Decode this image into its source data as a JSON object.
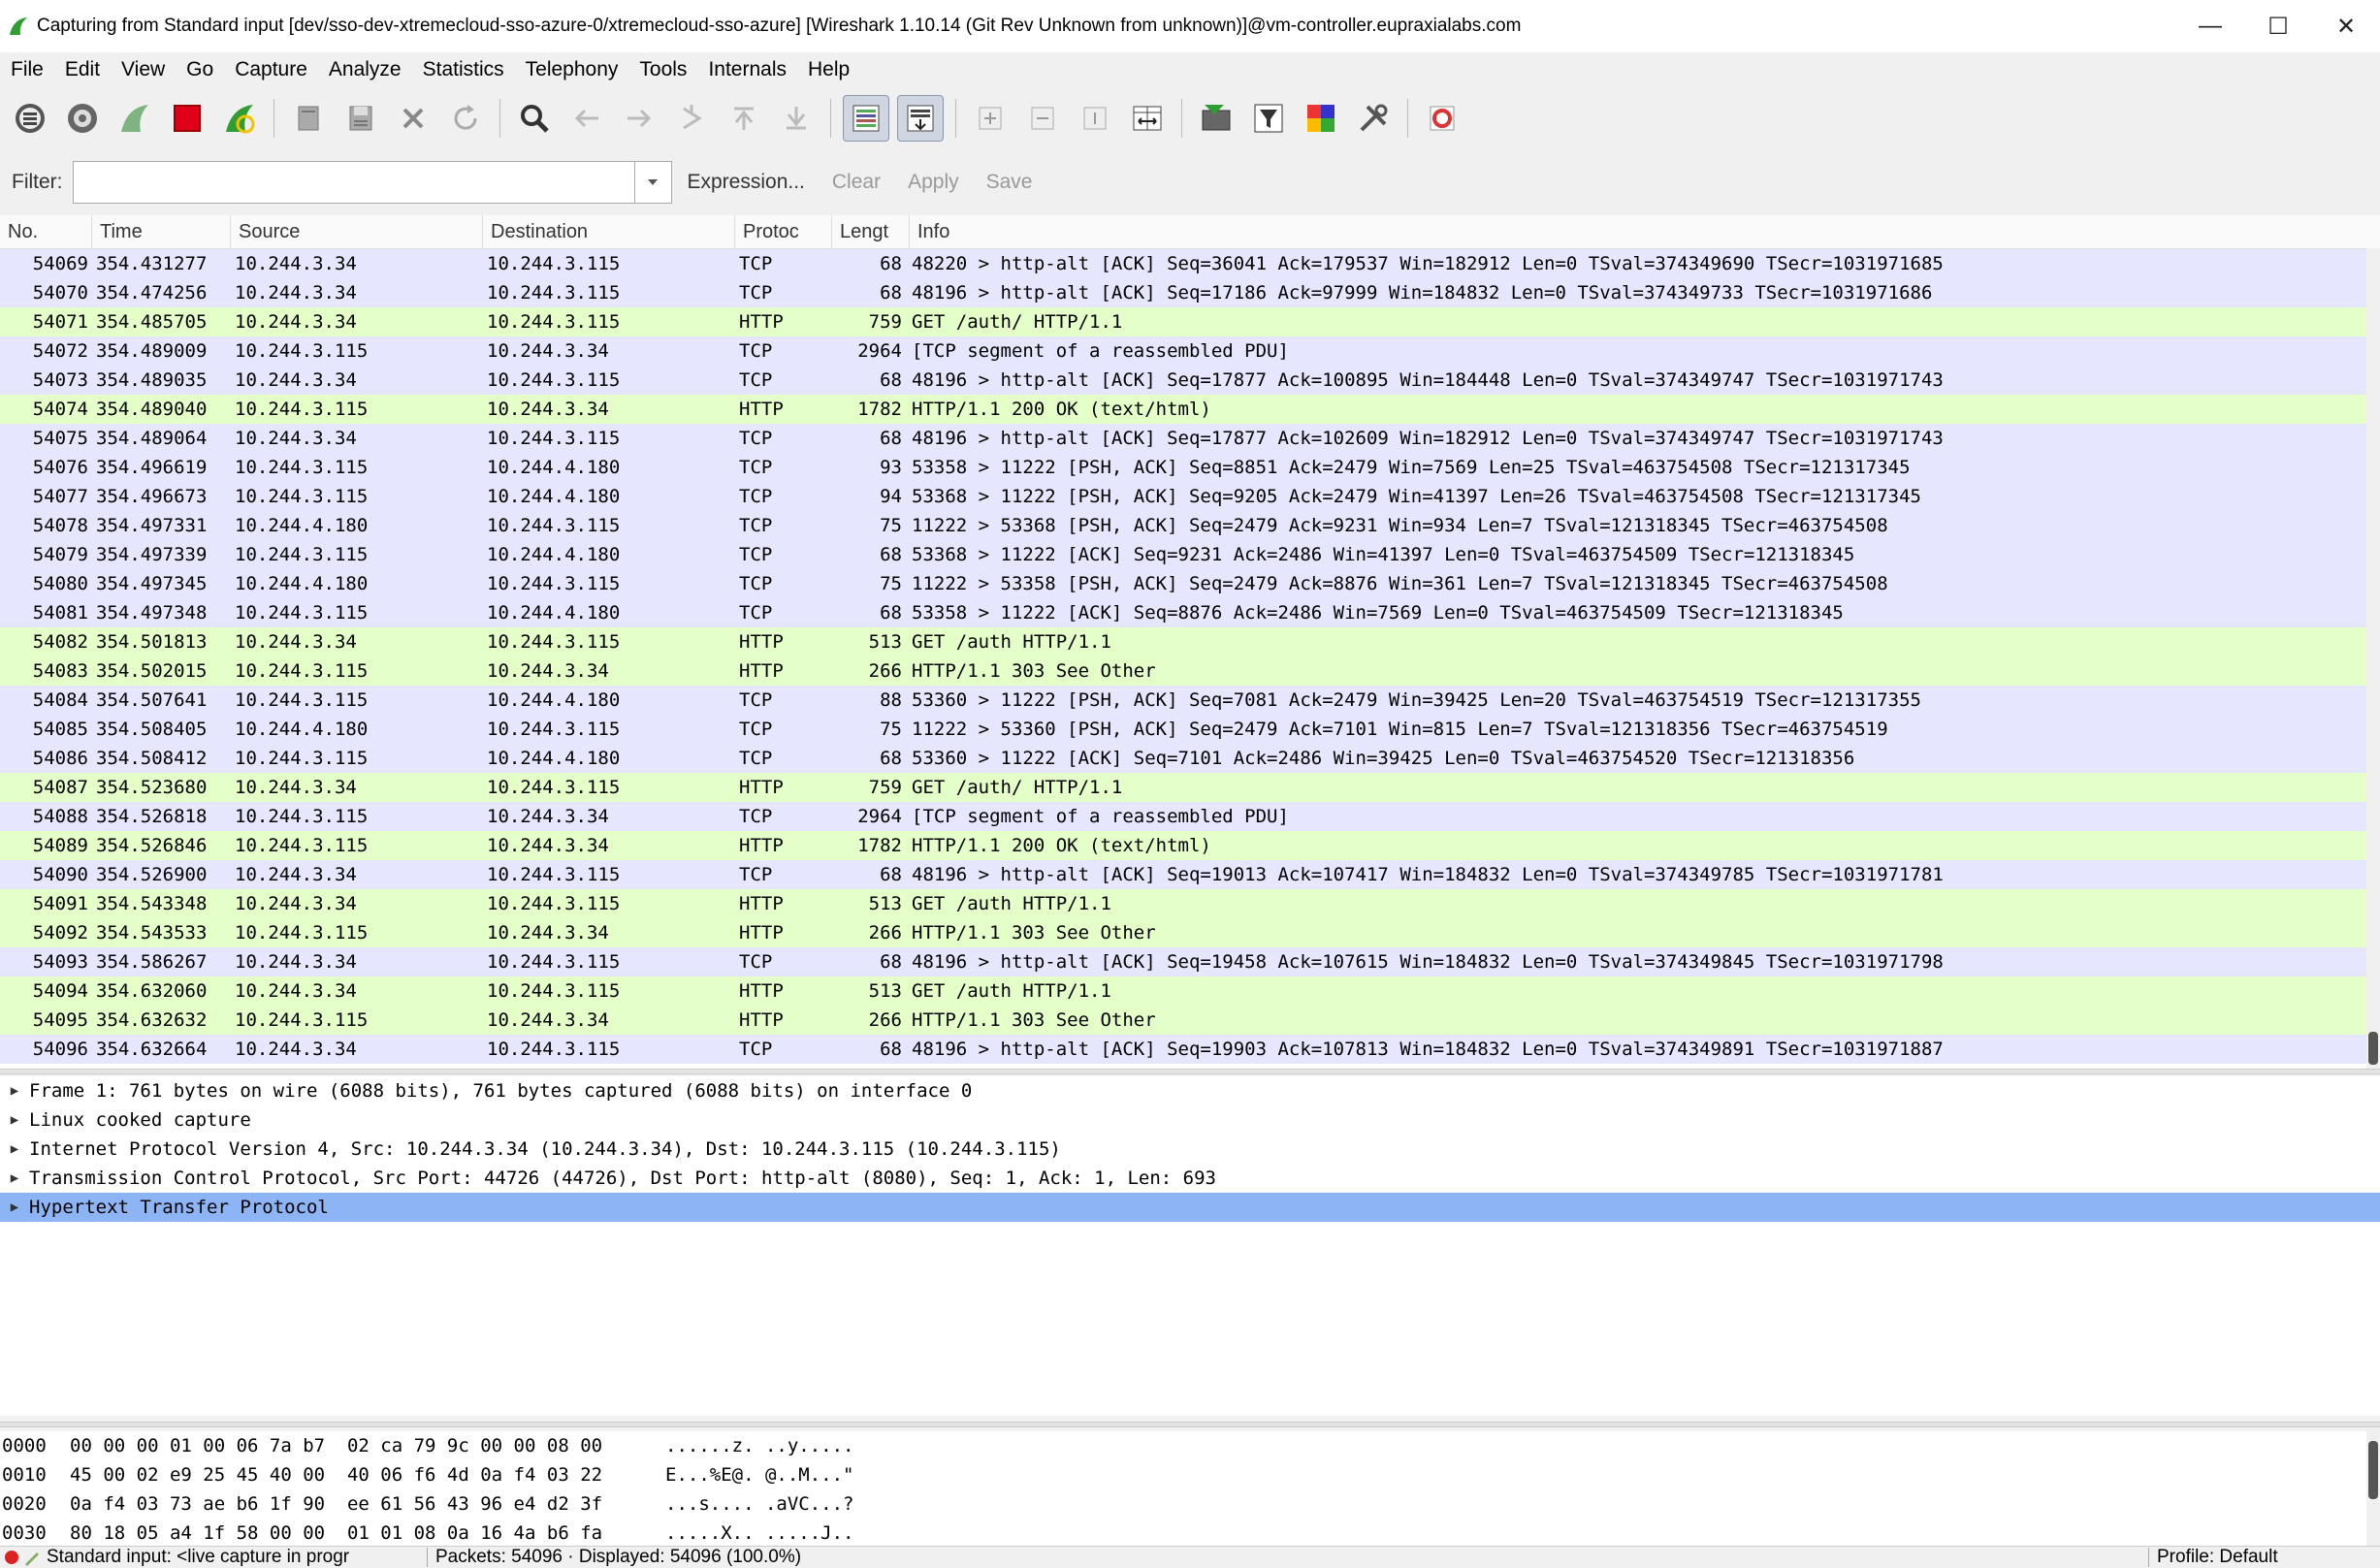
{
  "window": {
    "title": "Capturing from Standard input    [dev/sso-dev-xtremecloud-sso-azure-0/xtremecloud-sso-azure]   [Wireshark 1.10.14  (Git Rev Unknown from unknown)]@vm-controller.eupraxialabs.com",
    "minimize": "—",
    "maximize": "☐",
    "close": "✕"
  },
  "menu": [
    "File",
    "Edit",
    "View",
    "Go",
    "Capture",
    "Analyze",
    "Statistics",
    "Telephony",
    "Tools",
    "Internals",
    "Help"
  ],
  "filter": {
    "label": "Filter:",
    "value": "",
    "expression": "Expression...",
    "clear": "Clear",
    "apply": "Apply",
    "save": "Save"
  },
  "columns": [
    "No.",
    "Time",
    "Source",
    "Destination",
    "Protoc",
    "Lengt",
    "Info"
  ],
  "packets": [
    {
      "no": "54069",
      "time": "354.431277",
      "src": "10.244.3.34",
      "dst": "10.244.3.115",
      "proto": "TCP",
      "len": "68",
      "info": "48220 > http-alt [ACK] Seq=36041 Ack=179537 Win=182912 Len=0 TSval=374349690 TSecr=1031971685"
    },
    {
      "no": "54070",
      "time": "354.474256",
      "src": "10.244.3.34",
      "dst": "10.244.3.115",
      "proto": "TCP",
      "len": "68",
      "info": "48196 > http-alt [ACK] Seq=17186 Ack=97999 Win=184832 Len=0 TSval=374349733 TSecr=1031971686"
    },
    {
      "no": "54071",
      "time": "354.485705",
      "src": "10.244.3.34",
      "dst": "10.244.3.115",
      "proto": "HTTP",
      "len": "759",
      "info": "GET /auth/ HTTP/1.1"
    },
    {
      "no": "54072",
      "time": "354.489009",
      "src": "10.244.3.115",
      "dst": "10.244.3.34",
      "proto": "TCP",
      "len": "2964",
      "info": "[TCP segment of a reassembled PDU]"
    },
    {
      "no": "54073",
      "time": "354.489035",
      "src": "10.244.3.34",
      "dst": "10.244.3.115",
      "proto": "TCP",
      "len": "68",
      "info": "48196 > http-alt [ACK] Seq=17877 Ack=100895 Win=184448 Len=0 TSval=374349747 TSecr=1031971743"
    },
    {
      "no": "54074",
      "time": "354.489040",
      "src": "10.244.3.115",
      "dst": "10.244.3.34",
      "proto": "HTTP",
      "len": "1782",
      "info": "HTTP/1.1 200 OK  (text/html)"
    },
    {
      "no": "54075",
      "time": "354.489064",
      "src": "10.244.3.34",
      "dst": "10.244.3.115",
      "proto": "TCP",
      "len": "68",
      "info": "48196 > http-alt [ACK] Seq=17877 Ack=102609 Win=182912 Len=0 TSval=374349747 TSecr=1031971743"
    },
    {
      "no": "54076",
      "time": "354.496619",
      "src": "10.244.3.115",
      "dst": "10.244.4.180",
      "proto": "TCP",
      "len": "93",
      "info": "53358 > 11222 [PSH, ACK] Seq=8851 Ack=2479 Win=7569 Len=25 TSval=463754508 TSecr=121317345"
    },
    {
      "no": "54077",
      "time": "354.496673",
      "src": "10.244.3.115",
      "dst": "10.244.4.180",
      "proto": "TCP",
      "len": "94",
      "info": "53368 > 11222 [PSH, ACK] Seq=9205 Ack=2479 Win=41397 Len=26 TSval=463754508 TSecr=121317345"
    },
    {
      "no": "54078",
      "time": "354.497331",
      "src": "10.244.4.180",
      "dst": "10.244.3.115",
      "proto": "TCP",
      "len": "75",
      "info": "11222 > 53368 [PSH, ACK] Seq=2479 Ack=9231 Win=934 Len=7 TSval=121318345 TSecr=463754508"
    },
    {
      "no": "54079",
      "time": "354.497339",
      "src": "10.244.3.115",
      "dst": "10.244.4.180",
      "proto": "TCP",
      "len": "68",
      "info": "53368 > 11222 [ACK] Seq=9231 Ack=2486 Win=41397 Len=0 TSval=463754509 TSecr=121318345"
    },
    {
      "no": "54080",
      "time": "354.497345",
      "src": "10.244.4.180",
      "dst": "10.244.3.115",
      "proto": "TCP",
      "len": "75",
      "info": "11222 > 53358 [PSH, ACK] Seq=2479 Ack=8876 Win=361 Len=7 TSval=121318345 TSecr=463754508"
    },
    {
      "no": "54081",
      "time": "354.497348",
      "src": "10.244.3.115",
      "dst": "10.244.4.180",
      "proto": "TCP",
      "len": "68",
      "info": "53358 > 11222 [ACK] Seq=8876 Ack=2486 Win=7569 Len=0 TSval=463754509 TSecr=121318345"
    },
    {
      "no": "54082",
      "time": "354.501813",
      "src": "10.244.3.34",
      "dst": "10.244.3.115",
      "proto": "HTTP",
      "len": "513",
      "info": "GET /auth HTTP/1.1"
    },
    {
      "no": "54083",
      "time": "354.502015",
      "src": "10.244.3.115",
      "dst": "10.244.3.34",
      "proto": "HTTP",
      "len": "266",
      "info": "HTTP/1.1 303 See Other"
    },
    {
      "no": "54084",
      "time": "354.507641",
      "src": "10.244.3.115",
      "dst": "10.244.4.180",
      "proto": "TCP",
      "len": "88",
      "info": "53360 > 11222 [PSH, ACK] Seq=7081 Ack=2479 Win=39425 Len=20 TSval=463754519 TSecr=121317355"
    },
    {
      "no": "54085",
      "time": "354.508405",
      "src": "10.244.4.180",
      "dst": "10.244.3.115",
      "proto": "TCP",
      "len": "75",
      "info": "11222 > 53360 [PSH, ACK] Seq=2479 Ack=7101 Win=815 Len=7 TSval=121318356 TSecr=463754519"
    },
    {
      "no": "54086",
      "time": "354.508412",
      "src": "10.244.3.115",
      "dst": "10.244.4.180",
      "proto": "TCP",
      "len": "68",
      "info": "53360 > 11222 [ACK] Seq=7101 Ack=2486 Win=39425 Len=0 TSval=463754520 TSecr=121318356"
    },
    {
      "no": "54087",
      "time": "354.523680",
      "src": "10.244.3.34",
      "dst": "10.244.3.115",
      "proto": "HTTP",
      "len": "759",
      "info": "GET /auth/ HTTP/1.1"
    },
    {
      "no": "54088",
      "time": "354.526818",
      "src": "10.244.3.115",
      "dst": "10.244.3.34",
      "proto": "TCP",
      "len": "2964",
      "info": "[TCP segment of a reassembled PDU]"
    },
    {
      "no": "54089",
      "time": "354.526846",
      "src": "10.244.3.115",
      "dst": "10.244.3.34",
      "proto": "HTTP",
      "len": "1782",
      "info": "HTTP/1.1 200 OK  (text/html)"
    },
    {
      "no": "54090",
      "time": "354.526900",
      "src": "10.244.3.34",
      "dst": "10.244.3.115",
      "proto": "TCP",
      "len": "68",
      "info": "48196 > http-alt [ACK] Seq=19013 Ack=107417 Win=184832 Len=0 TSval=374349785 TSecr=1031971781"
    },
    {
      "no": "54091",
      "time": "354.543348",
      "src": "10.244.3.34",
      "dst": "10.244.3.115",
      "proto": "HTTP",
      "len": "513",
      "info": "GET /auth HTTP/1.1"
    },
    {
      "no": "54092",
      "time": "354.543533",
      "src": "10.244.3.115",
      "dst": "10.244.3.34",
      "proto": "HTTP",
      "len": "266",
      "info": "HTTP/1.1 303 See Other"
    },
    {
      "no": "54093",
      "time": "354.586267",
      "src": "10.244.3.34",
      "dst": "10.244.3.115",
      "proto": "TCP",
      "len": "68",
      "info": "48196 > http-alt [ACK] Seq=19458 Ack=107615 Win=184832 Len=0 TSval=374349845 TSecr=1031971798"
    },
    {
      "no": "54094",
      "time": "354.632060",
      "src": "10.244.3.34",
      "dst": "10.244.3.115",
      "proto": "HTTP",
      "len": "513",
      "info": "GET /auth HTTP/1.1"
    },
    {
      "no": "54095",
      "time": "354.632632",
      "src": "10.244.3.115",
      "dst": "10.244.3.34",
      "proto": "HTTP",
      "len": "266",
      "info": "HTTP/1.1 303 See Other"
    },
    {
      "no": "54096",
      "time": "354.632664",
      "src": "10.244.3.34",
      "dst": "10.244.3.115",
      "proto": "TCP",
      "len": "68",
      "info": "48196 > http-alt [ACK] Seq=19903 Ack=107813 Win=184832 Len=0 TSval=374349891 TSecr=1031971887"
    }
  ],
  "details": [
    {
      "text": "Frame 1: 761 bytes on wire (6088 bits), 761 bytes captured (6088 bits) on interface 0",
      "selected": false
    },
    {
      "text": "Linux cooked capture",
      "selected": false
    },
    {
      "text": "Internet Protocol Version 4, Src: 10.244.3.34 (10.244.3.34), Dst: 10.244.3.115 (10.244.3.115)",
      "selected": false
    },
    {
      "text": "Transmission Control Protocol, Src Port: 44726 (44726), Dst Port: http-alt (8080), Seq: 1, Ack: 1, Len: 693",
      "selected": false
    },
    {
      "text": "Hypertext Transfer Protocol",
      "selected": true
    }
  ],
  "hex": [
    {
      "offset": "0000",
      "hex": "00 00 00 01 00 06 7a b7  02 ca 79 9c 00 00 08 00",
      "ascii": "......z. ..y....."
    },
    {
      "offset": "0010",
      "hex": "45 00 02 e9 25 45 40 00  40 06 f6 4d 0a f4 03 22",
      "ascii": "E...%E@. @..M...\""
    },
    {
      "offset": "0020",
      "hex": "0a f4 03 73 ae b6 1f 90  ee 61 56 43 96 e4 d2 3f",
      "ascii": "...s.... .aVC...?"
    },
    {
      "offset": "0030",
      "hex": "80 18 05 a4 1f 58 00 00  01 01 08 0a 16 4a b6 fa",
      "ascii": ".....X.. .....J.."
    }
  ],
  "status": {
    "source": "Standard input: <live capture in progr",
    "packets": "Packets: 54096 · Displayed: 54096 (100.0%)",
    "profile": "Profile: Default"
  },
  "colors": {
    "tcp_row": "#e7e6ff",
    "http_row": "#e4ffc7",
    "selected_detail": "#8db4f5",
    "shark_fin": "#2e9e33",
    "stop_red": "#e0001b"
  }
}
